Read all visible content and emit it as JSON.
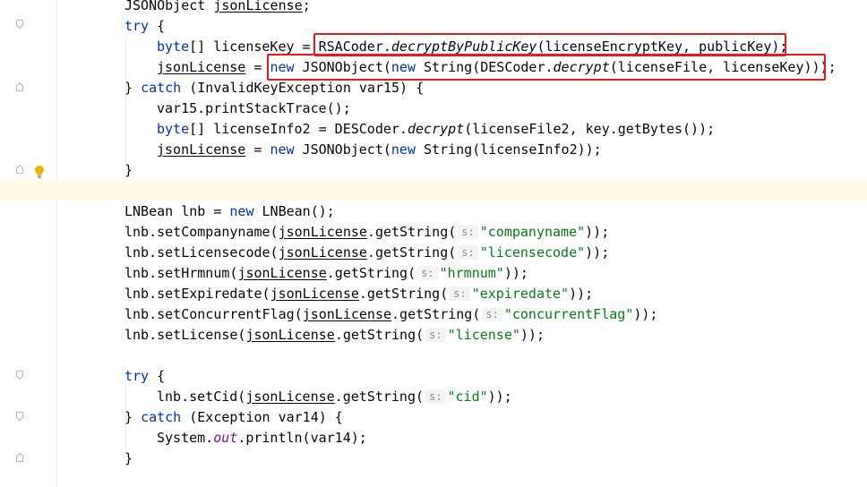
{
  "editor": {
    "lines": [
      {
        "segments": [
          {
            "t": "JSONObject "
          },
          {
            "t": "jsonLicense",
            "c": "ul"
          },
          {
            "t": ";"
          }
        ]
      },
      {
        "segments": [
          {
            "t": "try",
            "c": "kw"
          },
          {
            "t": " {"
          }
        ]
      },
      {
        "segments": [
          {
            "t": "byte",
            "c": "kw"
          },
          {
            "t": "[] licenseKey = RSACoder."
          },
          {
            "t": "decryptByPublicKey",
            "c": "meth-it"
          },
          {
            "t": "(licenseEncryptKey, publicKey);"
          }
        ]
      },
      {
        "segments": [
          {
            "t": "jsonLicense",
            "c": "ul"
          },
          {
            "t": " = "
          },
          {
            "t": "new",
            "c": "kw"
          },
          {
            "t": " JSONObject("
          },
          {
            "t": "new",
            "c": "kw"
          },
          {
            "t": " String(DESCoder."
          },
          {
            "t": "decrypt",
            "c": "meth-it"
          },
          {
            "t": "(licenseFile, licenseKey)));"
          }
        ]
      },
      {
        "segments": [
          {
            "t": "} "
          },
          {
            "t": "catch",
            "c": "kw"
          },
          {
            "t": " (InvalidKeyException var15) {"
          }
        ]
      },
      {
        "segments": [
          {
            "t": "var15.printStackTrace();"
          }
        ]
      },
      {
        "segments": [
          {
            "t": "byte",
            "c": "kw"
          },
          {
            "t": "[] licenseInfo2 = DESCoder."
          },
          {
            "t": "decrypt",
            "c": "meth-it"
          },
          {
            "t": "(licenseFile2, key.getBytes());"
          }
        ]
      },
      {
        "segments": [
          {
            "t": "jsonLicense",
            "c": "ul"
          },
          {
            "t": " = "
          },
          {
            "t": "new",
            "c": "kw"
          },
          {
            "t": " JSONObject("
          },
          {
            "t": "new",
            "c": "kw"
          },
          {
            "t": " String(licenseInfo2));"
          }
        ]
      },
      {
        "segments": [
          {
            "t": "}"
          }
        ]
      },
      {
        "segments": []
      },
      {
        "segments": [
          {
            "t": "LNBean lnb = "
          },
          {
            "t": "new",
            "c": "kw"
          },
          {
            "t": " LNBean();"
          }
        ]
      },
      {
        "segments": [
          {
            "t": "lnb.setCompanyname("
          },
          {
            "t": "jsonLicense",
            "c": "ul"
          },
          {
            "t": ".getString("
          },
          {
            "t": "s:",
            "c": "hint"
          },
          {
            "t": "\"companyname\"",
            "c": "str"
          },
          {
            "t": "));"
          }
        ]
      },
      {
        "segments": [
          {
            "t": "lnb.setLicensecode("
          },
          {
            "t": "jsonLicense",
            "c": "ul"
          },
          {
            "t": ".getString("
          },
          {
            "t": "s:",
            "c": "hint"
          },
          {
            "t": "\"licensecode\"",
            "c": "str"
          },
          {
            "t": "));"
          }
        ]
      },
      {
        "segments": [
          {
            "t": "lnb.setHrmnum("
          },
          {
            "t": "jsonLicense",
            "c": "ul"
          },
          {
            "t": ".getString("
          },
          {
            "t": "s:",
            "c": "hint"
          },
          {
            "t": "\"hrmnum\"",
            "c": "str"
          },
          {
            "t": "));"
          }
        ]
      },
      {
        "segments": [
          {
            "t": "lnb.setExpiredate("
          },
          {
            "t": "jsonLicense",
            "c": "ul"
          },
          {
            "t": ".getString("
          },
          {
            "t": "s:",
            "c": "hint"
          },
          {
            "t": "\"expiredate\"",
            "c": "str"
          },
          {
            "t": "));"
          }
        ]
      },
      {
        "segments": [
          {
            "t": "lnb.setConcurrentFlag("
          },
          {
            "t": "jsonLicense",
            "c": "ul"
          },
          {
            "t": ".getString("
          },
          {
            "t": "s:",
            "c": "hint"
          },
          {
            "t": "\"concurrentFlag\"",
            "c": "str"
          },
          {
            "t": "));"
          }
        ]
      },
      {
        "segments": [
          {
            "t": "lnb.setLicense("
          },
          {
            "t": "jsonLicense",
            "c": "ul"
          },
          {
            "t": ".getString("
          },
          {
            "t": "s:",
            "c": "hint"
          },
          {
            "t": "\"license\"",
            "c": "str"
          },
          {
            "t": "));"
          }
        ]
      },
      {
        "segments": []
      },
      {
        "segments": [
          {
            "t": "try",
            "c": "kw"
          },
          {
            "t": " {"
          }
        ]
      },
      {
        "segments": [
          {
            "t": "lnb.setCid("
          },
          {
            "t": "jsonLicense",
            "c": "ul"
          },
          {
            "t": ".getString("
          },
          {
            "t": "s:",
            "c": "hint"
          },
          {
            "t": "\"cid\"",
            "c": "str"
          },
          {
            "t": "));"
          }
        ]
      },
      {
        "segments": [
          {
            "t": "} "
          },
          {
            "t": "catch",
            "c": "kw"
          },
          {
            "t": " (Exception var14) {"
          }
        ]
      },
      {
        "segments": [
          {
            "t": "System."
          },
          {
            "t": "out",
            "c": "fld meth-it"
          },
          {
            "t": ".println(var14);"
          }
        ]
      },
      {
        "segments": [
          {
            "t": "}"
          }
        ]
      }
    ]
  },
  "colors": {
    "keyword": "#0033b3",
    "string": "#067d17",
    "field": "#871094",
    "highlight_box": "#e31b1b",
    "current_line": "#fffbe5"
  },
  "icons": [
    "fold-marker-icon",
    "lightbulb-icon"
  ]
}
